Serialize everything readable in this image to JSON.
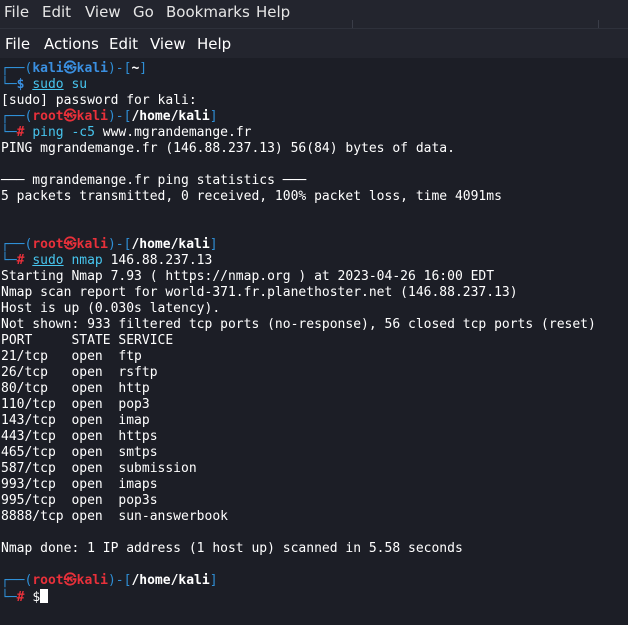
{
  "browser_menu": [
    "File",
    "Edit",
    "View",
    "Go",
    "Bookmarks",
    "Help"
  ],
  "terminal_menu": [
    "File",
    "Actions",
    "Edit",
    "View",
    "Help"
  ],
  "colors": {
    "prompt_user": "#3a8fe0",
    "prompt_root": "#e8303a",
    "command": "#47c5ee",
    "box": "#2f8fd6"
  },
  "prompt_kali": {
    "top": "┌──(",
    "user": "kali",
    "at": "㉿",
    "host": "kali",
    "mid": ")-[",
    "dir": "~",
    "end": "]",
    "bot": "└─",
    "sym": "$"
  },
  "prompt_root": {
    "top": "┌──(",
    "user": "root",
    "at": "㉿",
    "host": "kali",
    "mid": ")-[",
    "dir": "/home/kali",
    "end": "]",
    "bot": "└─",
    "sym": "#"
  },
  "cmd1": {
    "a": "sudo",
    "b": " ",
    "c": "su"
  },
  "sudo_prompt": "[sudo] password for kali:",
  "cmd2": {
    "a": "ping",
    "b": " ",
    "c": "-c5",
    "d": " www.mgrandemange.fr"
  },
  "ping_out": [
    "PING mgrandemange.fr (146.88.237.13) 56(84) bytes of data.",
    "",
    "─── mgrandemange.fr ping statistics ───",
    "5 packets transmitted, 0 received, 100% packet loss, time 4091ms"
  ],
  "cmd3": {
    "a": "sudo",
    "b": " ",
    "c": "nmap",
    "d": " 146.88.237.13"
  },
  "nmap_out": [
    "Starting Nmap 7.93 ( https://nmap.org ) at 2023-04-26 16:00 EDT",
    "Nmap scan report for world-371.fr.planethoster.net (146.88.237.13)",
    "Host is up (0.030s latency).",
    "Not shown: 933 filtered tcp ports (no-response), 56 closed tcp ports (reset)",
    "PORT     STATE SERVICE",
    "21/tcp   open  ftp",
    "26/tcp   open  rsftp",
    "80/tcp   open  http",
    "110/tcp  open  pop3",
    "143/tcp  open  imap",
    "443/tcp  open  https",
    "465/tcp  open  smtps",
    "587/tcp  open  submission",
    "993/tcp  open  imaps",
    "995/tcp  open  pop3s",
    "8888/tcp open  sun-answerbook",
    "",
    "Nmap done: 1 IP address (1 host up) scanned in 5.58 seconds"
  ]
}
